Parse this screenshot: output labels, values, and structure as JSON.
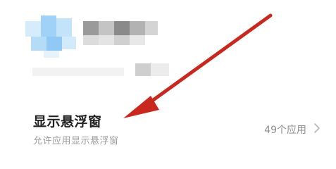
{
  "setting": {
    "title": "显示悬浮窗",
    "subtitle": "允许应用显示悬浮窗",
    "value": "49个应用"
  },
  "icons": {
    "chevron": "chevron-right-icon",
    "arrow": "annotation-arrow-icon"
  },
  "colors": {
    "arrow": "#c8281e",
    "title": "#222222",
    "subtitle": "#9a9a9a",
    "value": "#8c8c8c"
  }
}
